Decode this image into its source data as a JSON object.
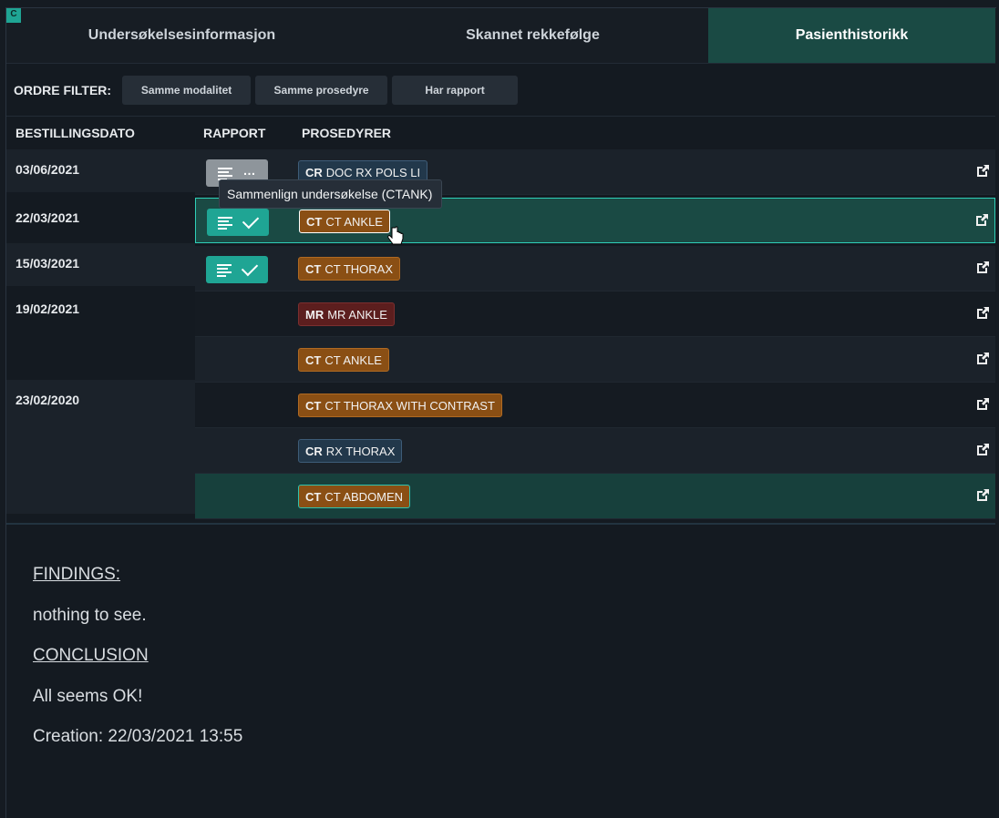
{
  "logo": "C",
  "tabs": [
    {
      "label": "Undersøkelsesinformasjon",
      "active": false
    },
    {
      "label": "Skannet rekkefølge",
      "active": false
    },
    {
      "label": "Pasienthistorikk",
      "active": true
    }
  ],
  "filter": {
    "label": "ORDRE FILTER:",
    "chips": [
      "Samme modalitet",
      "Samme prosedyre",
      "Har rapport"
    ]
  },
  "columns": {
    "date": "BESTILLINGSDATO",
    "report": "RAPPORT",
    "procedures": "PROSEDYRER"
  },
  "rows": [
    {
      "date": "03/06/2021",
      "report": "pending",
      "modality": "CR",
      "procedure": "DOC RX POLS LI"
    },
    {
      "date": "22/03/2021",
      "report": "ok",
      "modality": "CT",
      "procedure": "CT ANKLE",
      "selected": true
    },
    {
      "date": "15/03/2021",
      "report": "ok",
      "modality": "CT",
      "procedure": "CT THORAX"
    },
    {
      "date": "19/02/2021",
      "report": "none",
      "modality": "MR",
      "procedure": "MR ANKLE"
    },
    {
      "date": "",
      "report": "none",
      "modality": "CT",
      "procedure": "CT ANKLE"
    },
    {
      "date": "23/02/2020",
      "report": "none",
      "modality": "CT",
      "procedure": "CT THORAX WITH CONTRAST"
    },
    {
      "date": "",
      "report": "none",
      "modality": "CR",
      "procedure": "RX THORAX"
    },
    {
      "date": "",
      "report": "none",
      "modality": "CT",
      "procedure": "CT ABDOMEN",
      "highlighted": true
    }
  ],
  "tooltip": "Sammenlign undersøkelse (CTANK)",
  "report_text": {
    "findings_heading": "FINDINGS:",
    "findings": "nothing to see.",
    "conclusion_heading": "CONCLUSION",
    "conclusion": "All seems OK!",
    "creation": "Creation: 22/03/2021 13:55"
  },
  "colors": {
    "accent": "#1fa594",
    "ct": "#8a4f14",
    "cr": "#22384b",
    "mr": "#5c1e1e",
    "selected_row": "#1a4a44"
  }
}
